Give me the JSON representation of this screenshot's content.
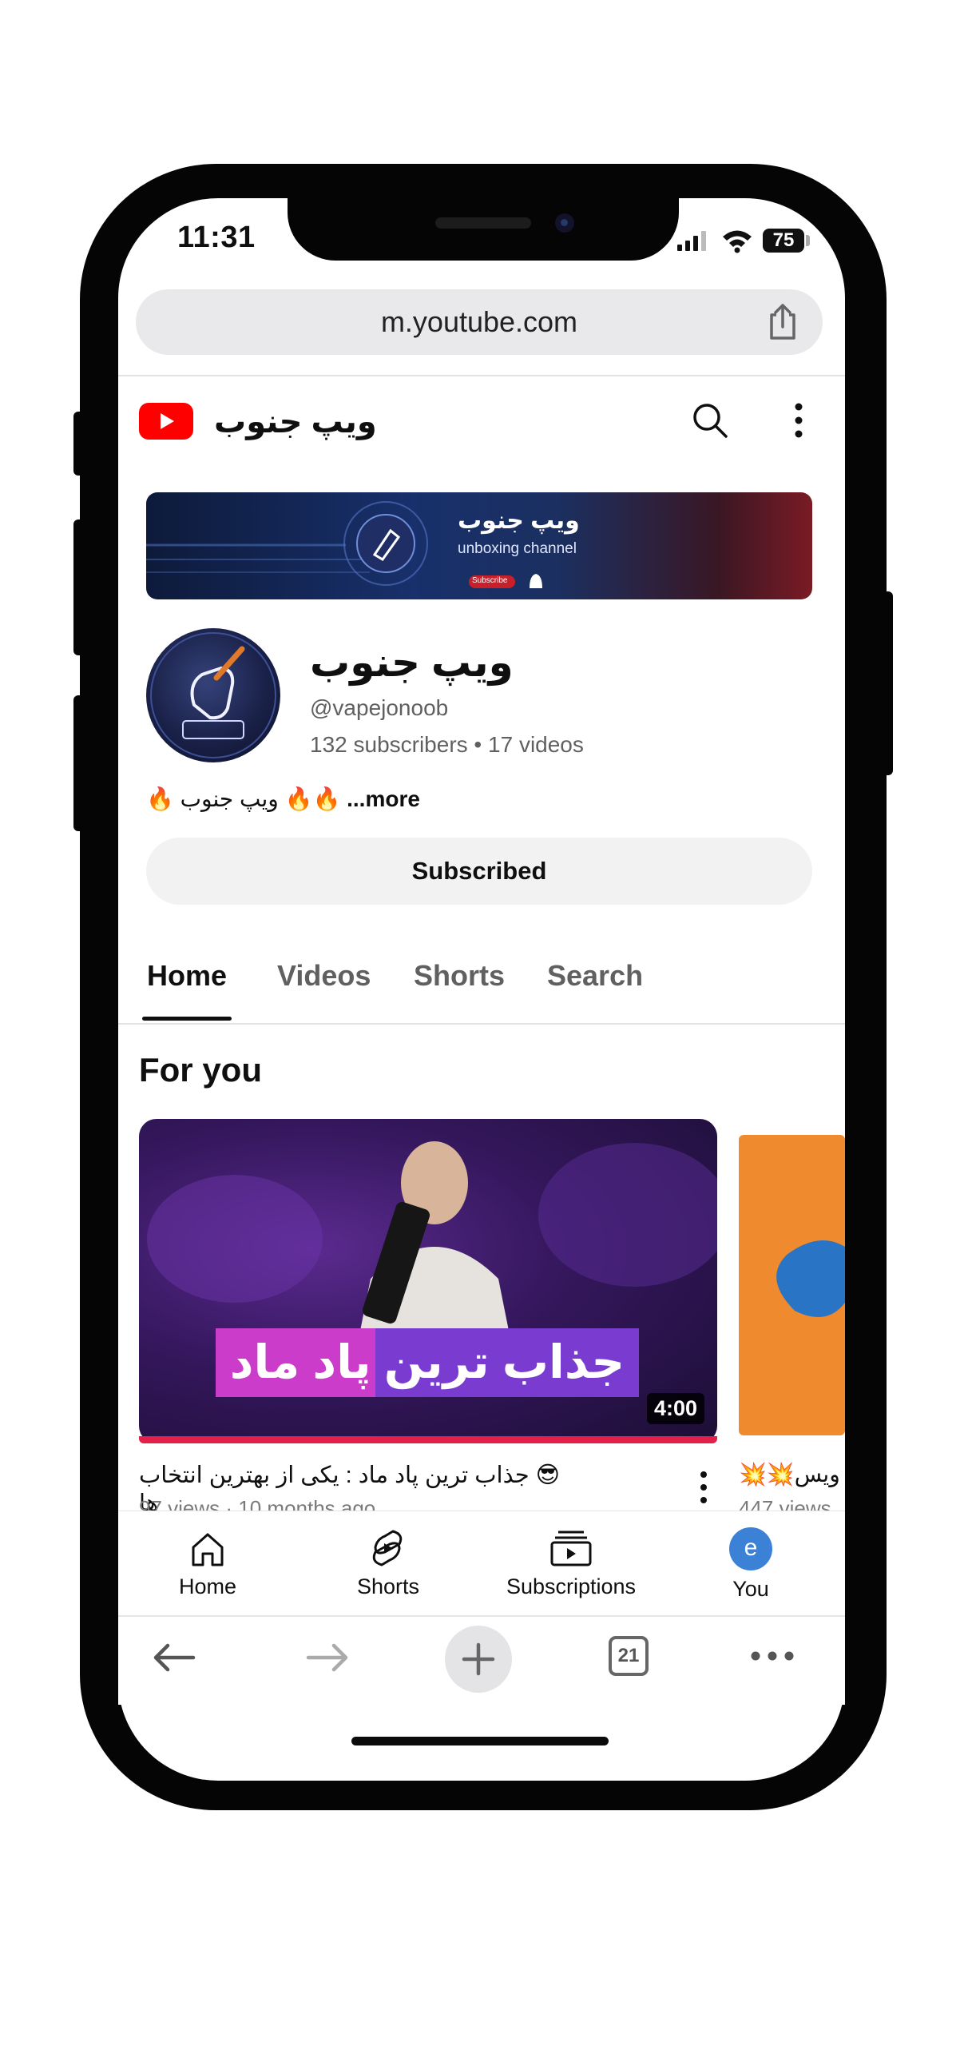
{
  "status_bar": {
    "time": "11:31",
    "battery": "75"
  },
  "browser": {
    "url": "m.youtube.com",
    "tab_count": "21"
  },
  "app_header": {
    "channel_title": "ویپ جنوب"
  },
  "channel": {
    "banner_title": "ویپ جنوب",
    "banner_subtitle": "unboxing channel",
    "banner_button": "Subscribe",
    "name": "ویپ جنوب",
    "handle": "@vapejonoob",
    "stats": "132 subscribers • 17 videos",
    "description": "🔥 ویپ جنوب 🔥🔥",
    "more_label": "...more",
    "subscribe_state": "Subscribed"
  },
  "tabs": [
    {
      "label": "Home",
      "active": true
    },
    {
      "label": "Videos",
      "active": false
    },
    {
      "label": "Shorts",
      "active": false
    },
    {
      "label": "Search",
      "active": false
    }
  ],
  "section": {
    "title": "For you"
  },
  "videos": [
    {
      "thumbnail_caption": "جذاب ترین پاد ماد",
      "duration": "4:00",
      "title": "😎 جذاب ترین پاد ماد : یکی از بهترین انتخاب ها",
      "meta": "97 views · 10 months ago",
      "progress_fraction": 1.0
    },
    {
      "title": "💥💥ویس",
      "meta": "447 views"
    }
  ],
  "bottom_nav": [
    {
      "label": "Home",
      "icon": "home-icon"
    },
    {
      "label": "Shorts",
      "icon": "shorts-icon"
    },
    {
      "label": "Subscriptions",
      "icon": "subscriptions-icon"
    },
    {
      "label": "You",
      "icon": "avatar-icon",
      "avatar_letter": "e"
    }
  ],
  "colors": {
    "youtube_red": "#ff0000",
    "progress_red": "#e4204a",
    "avatar_blue": "#3b82d6",
    "text_primary": "#0f0f0f",
    "text_secondary": "#606060"
  }
}
